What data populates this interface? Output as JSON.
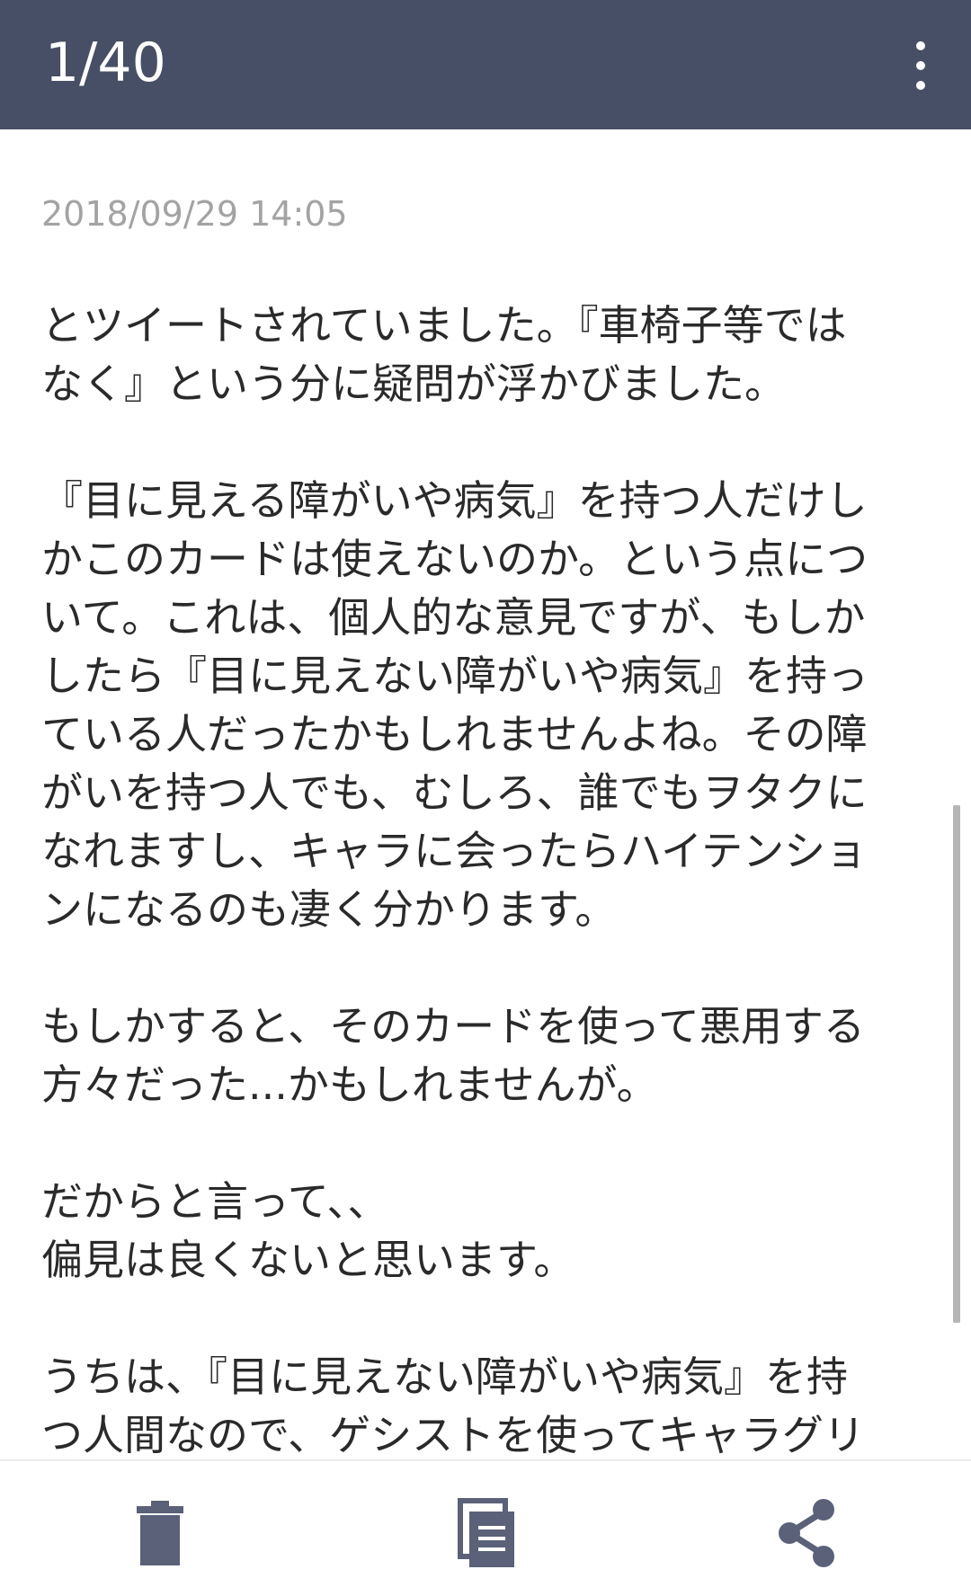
{
  "header": {
    "page_counter": "1/40",
    "more_icon": "more-vert-icon"
  },
  "note": {
    "timestamp": "2018/09/29 14:05",
    "paragraphs": [
      "とツイートされていました。『車椅子等では\nなく』という分に疑問が浮かびました。",
      "『目に見える障がいや病気』を持つ人だけし\nかこのカードは使えないのか。という点につ\nいて。これは、個人的な意見ですが、もしか\nしたら『目に見えない障がいや病気』を持っ\nている人だったかもしれませんよね。その障\nがいを持つ人でも、むしろ、誰でもヲタクに\nなれますし、キャラに会ったらハイテンショ\nンになるのも凄く分かります。",
      "もしかすると、そのカードを使って悪用する\n方々だった...かもしれませんが。",
      "だからと言って、、\n偏見は良くないと思います。",
      "うちは、『目に見えない障がいや病気』を持\nつ人間なので、ゲシストを使ってキャラグリ"
    ]
  },
  "bottom_bar": {
    "delete_icon": "trash-icon",
    "copy_icon": "copy-icon",
    "share_icon": "share-icon"
  },
  "colors": {
    "header_bg": "#474f66",
    "icon_color": "#5a6179",
    "timestamp_color": "#a3a3a3",
    "text_color": "#2a2a2a"
  }
}
